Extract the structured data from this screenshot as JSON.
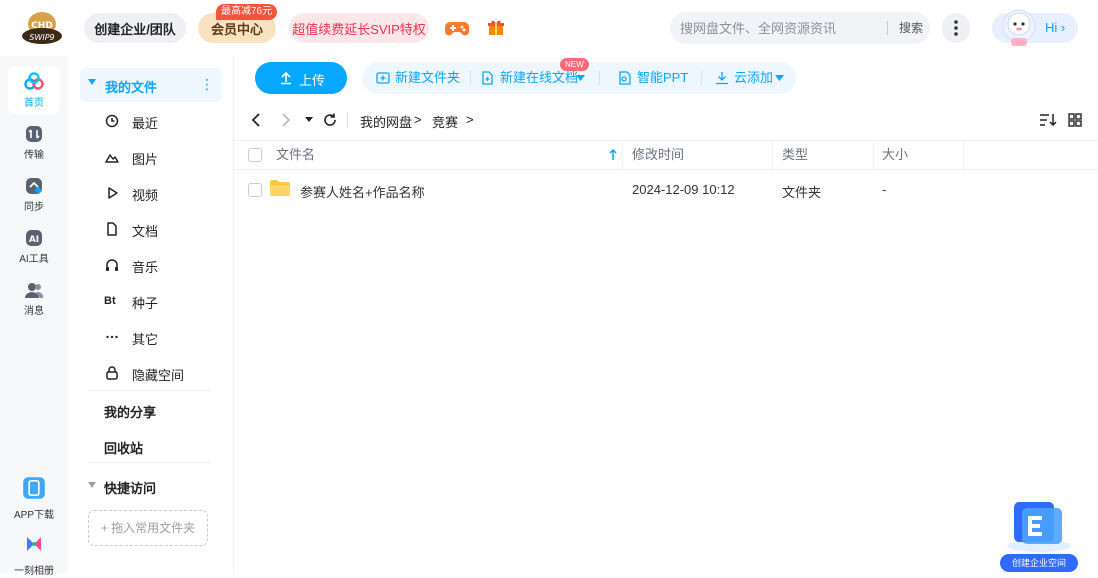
{
  "header": {
    "logo_text": "CHD SWIP9",
    "enterprise_label": "创建企业/团队",
    "vip_label": "会员中心",
    "vip_badge": "最高减76元",
    "svip_label": "超值续费延长SVIP特权",
    "search": {
      "placeholder": "搜网盘文件、全网资源资讯",
      "button": "搜索"
    },
    "user_greeting": "Hi"
  },
  "rail": {
    "items": [
      {
        "label": "首页"
      },
      {
        "label": "传输"
      },
      {
        "label": "同步"
      },
      {
        "label": "AI工具"
      },
      {
        "label": "消息"
      }
    ],
    "bottom": [
      {
        "label": "APP下载"
      },
      {
        "label": "一刻相册"
      }
    ]
  },
  "sidebar": {
    "my_files": "我的文件",
    "items": [
      {
        "label": "最近"
      },
      {
        "label": "图片"
      },
      {
        "label": "视频"
      },
      {
        "label": "文档"
      },
      {
        "label": "音乐"
      },
      {
        "label": "种子",
        "icon_text": "Bt"
      },
      {
        "label": "其它"
      },
      {
        "label": "隐藏空间"
      }
    ],
    "my_share": "我的分享",
    "recycle": "回收站",
    "quick_access": "快捷访问",
    "drag_hint": "+ 拖入常用文件夹"
  },
  "toolbar": {
    "upload": "上传",
    "new_folder": "新建文件夹",
    "new_online_doc": "新建在线文档",
    "new_badge": "NEW",
    "smart_ppt": "智能PPT",
    "cloud_add": "云添加"
  },
  "breadcrumb": [
    "我的网盘",
    "竞赛"
  ],
  "table": {
    "columns": [
      "文件名",
      "修改时间",
      "类型",
      "大小"
    ],
    "rows": [
      {
        "name": "参赛人姓名+作品名称",
        "modified": "2024-12-09 10:12",
        "type": "文件夹",
        "size": "-"
      }
    ]
  },
  "promo": {
    "label": "创建企业空间"
  },
  "colors": {
    "accent": "#06a7ff",
    "svip": "#f0334f",
    "folder": "#ffc83d"
  }
}
